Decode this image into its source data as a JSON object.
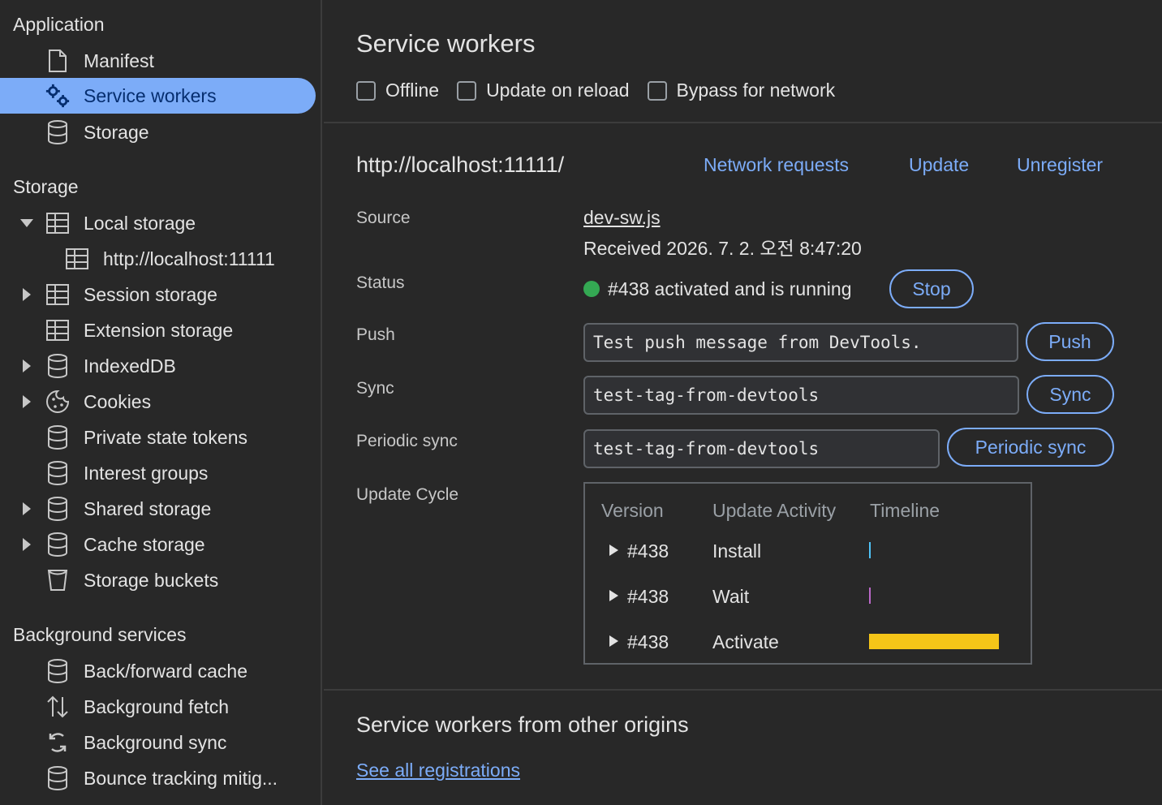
{
  "sidebar": {
    "application_header": "Application",
    "application_items": [
      {
        "label": "Manifest"
      },
      {
        "label": "Service workers"
      },
      {
        "label": "Storage"
      }
    ],
    "storage_header": "Storage",
    "storage_items": [
      {
        "label": "Local storage"
      },
      {
        "label": "http://localhost:11111"
      },
      {
        "label": "Session storage"
      },
      {
        "label": "Extension storage"
      },
      {
        "label": "IndexedDB"
      },
      {
        "label": "Cookies"
      },
      {
        "label": "Private state tokens"
      },
      {
        "label": "Interest groups"
      },
      {
        "label": "Shared storage"
      },
      {
        "label": "Cache storage"
      },
      {
        "label": "Storage buckets"
      }
    ],
    "background_header": "Background services",
    "background_items": [
      {
        "label": "Back/forward cache"
      },
      {
        "label": "Background fetch"
      },
      {
        "label": "Background sync"
      },
      {
        "label": "Bounce tracking mitig..."
      }
    ]
  },
  "main": {
    "title": "Service workers",
    "options": {
      "offline": "Offline",
      "update_on_reload": "Update on reload",
      "bypass": "Bypass for network"
    },
    "worker": {
      "origin": "http://localhost:11111/",
      "network_requests": "Network requests",
      "update": "Update",
      "unregister": "Unregister",
      "source_label": "Source",
      "source_file": "dev-sw.js",
      "received": "Received 2026. 7. 2. 오전 8:47:20",
      "status_label": "Status",
      "status_text": "#438 activated and is running",
      "stop": "Stop",
      "push_label": "Push",
      "push_value": "Test push message from DevTools.",
      "push_button": "Push",
      "sync_label": "Sync",
      "sync_value": "test-tag-from-devtools",
      "sync_button": "Sync",
      "periodic_label": "Periodic sync",
      "periodic_value": "test-tag-from-devtools",
      "periodic_button": "Periodic sync",
      "cycle_label": "Update Cycle",
      "cycle": {
        "col_version": "Version",
        "col_activity": "Update Activity",
        "col_timeline": "Timeline",
        "rows": [
          {
            "version": "#438",
            "activity": "Install",
            "color": "#4fc3f7"
          },
          {
            "version": "#438",
            "activity": "Wait",
            "color": "#ba68c8"
          },
          {
            "version": "#438",
            "activity": "Activate",
            "color": "#f5c518"
          }
        ]
      }
    },
    "other_title": "Service workers from other origins",
    "see_all": "See all registrations"
  },
  "colors": {
    "accent": "#7cacf8",
    "status_green": "#34a853",
    "background": "#282828"
  }
}
